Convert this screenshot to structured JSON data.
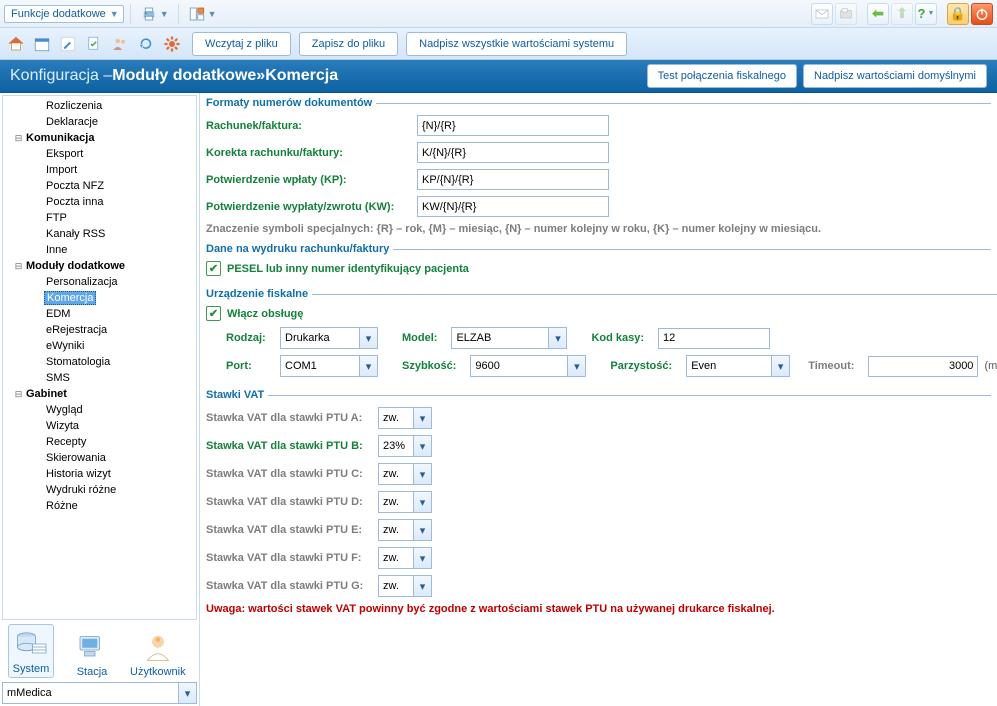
{
  "topbar": {
    "functions_label": "Funkcje dodatkowe"
  },
  "secondbar": {
    "load_from_file": "Wczytaj z pliku",
    "save_to_file": "Zapisz do pliku",
    "override_system": "Nadpisz wszystkie wartościami systemu"
  },
  "header": {
    "crumb1": "Konfiguracja – ",
    "crumb2": "Moduły dodatkowe",
    "sep": " » ",
    "crumb3": "Komercja",
    "test_btn": "Test połączenia fiskalnego",
    "defaults_btn": "Nadpisz wartościami domyślnymi"
  },
  "tree": [
    {
      "label": "Rozliczenia",
      "indent": 1
    },
    {
      "label": "Deklaracje",
      "indent": 1
    },
    {
      "label": "Komunikacja",
      "indent": 0,
      "bold": true,
      "twisty": "-"
    },
    {
      "label": "Eksport",
      "indent": 1
    },
    {
      "label": "Import",
      "indent": 1
    },
    {
      "label": "Poczta NFZ",
      "indent": 1
    },
    {
      "label": "Poczta inna",
      "indent": 1
    },
    {
      "label": "FTP",
      "indent": 1
    },
    {
      "label": "Kanały RSS",
      "indent": 1
    },
    {
      "label": "Inne",
      "indent": 1
    },
    {
      "label": "Moduły dodatkowe",
      "indent": 0,
      "bold": true,
      "twisty": "-"
    },
    {
      "label": "Personalizacja",
      "indent": 1
    },
    {
      "label": "Komercja",
      "indent": 1,
      "selected": true
    },
    {
      "label": "EDM",
      "indent": 1
    },
    {
      "label": "eRejestracja",
      "indent": 1
    },
    {
      "label": "eWyniki",
      "indent": 1
    },
    {
      "label": "Stomatologia",
      "indent": 1
    },
    {
      "label": "SMS",
      "indent": 1
    },
    {
      "label": "Gabinet",
      "indent": 0,
      "bold": true,
      "twisty": "-"
    },
    {
      "label": "Wygląd",
      "indent": 1
    },
    {
      "label": "Wizyta",
      "indent": 1
    },
    {
      "label": "Recepty",
      "indent": 1
    },
    {
      "label": "Skierowania",
      "indent": 1
    },
    {
      "label": "Historia wizyt",
      "indent": 1
    },
    {
      "label": "Wydruki różne",
      "indent": 1
    },
    {
      "label": "Różne",
      "indent": 1
    }
  ],
  "bottom_tabs": {
    "system": "System",
    "stacja": "Stacja",
    "user": "Użytkownik"
  },
  "profile_select": {
    "value": "mMedica"
  },
  "groups": {
    "formats": {
      "legend": "Formaty numerów dokumentów",
      "rows": [
        {
          "label": "Rachunek/faktura:",
          "value": "{N}/{R}"
        },
        {
          "label": "Korekta rachunku/faktury:",
          "value": "K/{N}/{R}"
        },
        {
          "label": "Potwierdzenie wpłaty (KP):",
          "value": "KP/{N}/{R}"
        },
        {
          "label": "Potwierdzenie wypłaty/zwrotu (KW):",
          "value": "KW/{N}/{R}"
        }
      ],
      "hint": "Znaczenie symboli specjalnych: {R} – rok, {M} – miesiąc, {N} – numer kolejny w roku, {K} – numer kolejny w miesiącu."
    },
    "print_data": {
      "legend": "Dane na wydruku rachunku/faktury",
      "checkbox_label": "PESEL lub inny numer identyfikujący pacjenta"
    },
    "fiscal": {
      "legend": "Urządzenie fiskalne",
      "enable_label": "Włącz obsługę",
      "kind_label": "Rodzaj:",
      "kind_value": "Drukarka",
      "model_label": "Model:",
      "model_value": "ELZAB",
      "cashier_label": "Kod kasy:",
      "cashier_value": "12",
      "port_label": "Port:",
      "port_value": "COM1",
      "speed_label": "Szybkość:",
      "speed_value": "9600",
      "parity_label": "Parzystość:",
      "parity_value": "Even",
      "timeout_label": "Timeout:",
      "timeout_value": "3000",
      "timeout_unit": "(ms)"
    },
    "vat": {
      "legend": "Stawki VAT",
      "rows": [
        {
          "label": "Stawka VAT dla stawki PTU A:",
          "value": "zw.",
          "active": false
        },
        {
          "label": "Stawka VAT dla stawki PTU B:",
          "value": "23%",
          "active": true
        },
        {
          "label": "Stawka VAT dla stawki PTU C:",
          "value": "zw.",
          "active": false
        },
        {
          "label": "Stawka VAT dla stawki PTU D:",
          "value": "zw.",
          "active": false
        },
        {
          "label": "Stawka VAT dla stawki PTU E:",
          "value": "zw.",
          "active": false
        },
        {
          "label": "Stawka VAT dla stawki PTU F:",
          "value": "zw.",
          "active": false
        },
        {
          "label": "Stawka VAT dla stawki PTU G:",
          "value": "zw.",
          "active": false
        }
      ],
      "warning": "Uwaga: wartości stawek VAT powinny być zgodne z wartościami stawek PTU na używanej drukarce fiskalnej."
    }
  }
}
